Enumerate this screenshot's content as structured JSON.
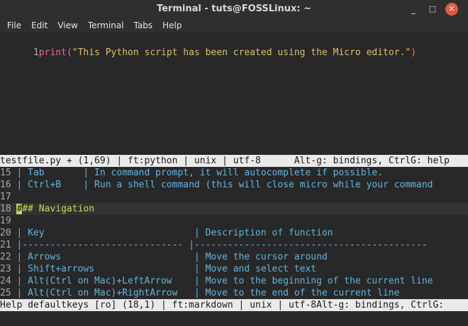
{
  "window": {
    "title": "Terminal - tuts@FOSSLinux: ~",
    "controls": {
      "minimize": "_",
      "maximize": "□",
      "close": "✕"
    }
  },
  "menubar": [
    "File",
    "Edit",
    "View",
    "Terminal",
    "Tabs",
    "Help"
  ],
  "editor_top": {
    "line_number": "1",
    "code": {
      "func": "print",
      "open": "(",
      "string": "\"This Python script has been created using the Micro editor.\"",
      "close": ")"
    },
    "status": "testfile.py + (1,69) | ft:python | unix | utf-8      Alt-g: bindings, CtrlG: help"
  },
  "editor_bottom": {
    "lines": [
      {
        "num": "15",
        "text": " | Tab       | In command prompt, it will autocomplete if possible."
      },
      {
        "num": "16",
        "text": " | Ctrl+B    | Run a shell command (this will close micro while your command"
      },
      {
        "num": "17",
        "text": ""
      },
      {
        "num": "18",
        "cursor": "#",
        "text": "## Navigation"
      },
      {
        "num": "19",
        "text": ""
      },
      {
        "num": "20",
        "text": " | Key                           | Description of function"
      },
      {
        "num": "21",
        "text": " |----------------------------- |------------------------------------------"
      },
      {
        "num": "22",
        "text": " | Arrows                        | Move the cursor around"
      },
      {
        "num": "23",
        "text": " | Shift+arrows                  | Move and select text"
      },
      {
        "num": "24",
        "text": " | Alt(Ctrl on Mac)+LeftArrow    | Move to the beginning of the current line"
      },
      {
        "num": "25",
        "text": " | Alt(Ctrl on Mac)+RightArrow   | Move to the end of the current line"
      }
    ],
    "status": "Help defaultkeys [ro] (18,1) | ft:markdown | unix | utf-8Alt-g: bindings, CtrlG:"
  },
  "colors": {
    "keyword": "#e36aa1",
    "string": "#d6c36b",
    "table_text": "#62b4e0",
    "heading": "#c7d957",
    "close_button": "#e05a3f"
  }
}
